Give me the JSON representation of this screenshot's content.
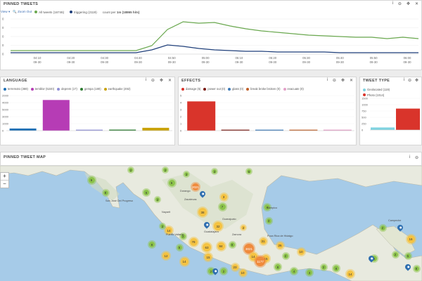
{
  "timeline": {
    "title": "PINNED TWEETS",
    "view_label": "View",
    "zoom_label": "Zoom Out",
    "legend": [
      {
        "label": "All tweets (16746)",
        "color": "#6aa84f"
      },
      {
        "label": "triggering (2119)",
        "color": "#1f3f7a"
      }
    ],
    "count_prefix": "count per",
    "count_interval": "1m",
    "count_total": "(18865 hits)",
    "yticks": [
      "0",
      "0",
      "0",
      "0",
      "0"
    ],
    "xticks": [
      {
        "time": "04:10",
        "date": "09-30"
      },
      {
        "time": "04:20",
        "date": "09-30"
      },
      {
        "time": "04:30",
        "date": "09-30"
      },
      {
        "time": "04:40",
        "date": "09-30"
      },
      {
        "time": "04:50",
        "date": "09-30"
      },
      {
        "time": "05:00",
        "date": "09-30"
      },
      {
        "time": "05:10",
        "date": "09-30"
      },
      {
        "time": "05:20",
        "date": "09-30"
      },
      {
        "time": "05:30",
        "date": "09-30"
      },
      {
        "time": "05:40",
        "date": "09-30"
      },
      {
        "time": "05:50",
        "date": "09-30"
      },
      {
        "time": "06:00",
        "date": "09-30"
      }
    ]
  },
  "chart_data": [
    {
      "type": "line",
      "title": "PINNED TWEETS",
      "x": [
        "04:05",
        "04:10",
        "04:15",
        "04:20",
        "04:25",
        "04:30",
        "04:35",
        "04:40",
        "04:43",
        "04:45",
        "04:48",
        "04:50",
        "04:55",
        "05:00",
        "05:05",
        "05:10",
        "05:15",
        "05:20",
        "05:25",
        "05:30",
        "05:35",
        "05:40",
        "05:45",
        "05:50",
        "05:55",
        "06:00",
        "06:05"
      ],
      "series": [
        {
          "name": "All tweets (16746)",
          "color": "#6aa84f",
          "values": [
            5,
            5,
            5,
            5,
            5,
            5,
            5,
            5,
            5,
            12,
            35,
            46,
            44,
            45,
            40,
            36,
            33,
            31,
            29,
            27,
            26,
            25,
            24,
            24,
            22,
            24,
            22
          ]
        },
        {
          "name": "triggering (2119)",
          "color": "#1f3f7a",
          "values": [
            2,
            2,
            2,
            2,
            2,
            2,
            2,
            2,
            2,
            6,
            13,
            11,
            8,
            6,
            5,
            4,
            4,
            3,
            3,
            3,
            3,
            2,
            2,
            2,
            2,
            2,
            2
          ]
        }
      ]
    },
    {
      "type": "bar",
      "title": "LANGUAGE",
      "categories": [
        "terremoto (369)",
        "temblor (5240)",
        "deprem (17)",
        "gempa (180)",
        "earthquake (492)"
      ],
      "values": [
        369,
        5240,
        17,
        180,
        492
      ],
      "colors": [
        "#1f6fb5",
        "#b63cb5",
        "#8f8fd6",
        "#2e7d32",
        "#c9a20a"
      ],
      "yticks": [
        "2000",
        "4000",
        "5000",
        "3000",
        "1000",
        "0"
      ],
      "ylim": [
        0,
        6000
      ]
    },
    {
      "type": "bar",
      "title": "EFFECTS",
      "categories": [
        "damage (5)",
        "power out (0)",
        "glass (0)",
        "break broke broken (0)",
        "evacuate (0)"
      ],
      "values": [
        5,
        0,
        0,
        0,
        0
      ],
      "colors": [
        "#d9342b",
        "#7a1b14",
        "#3d7ab8",
        "#c0612b",
        "#e3a0c8"
      ],
      "yticks": [
        "5",
        "4",
        "3",
        "2",
        "1",
        "0"
      ],
      "ylim": [
        0,
        6
      ]
    },
    {
      "type": "bar",
      "title": "TWEET TYPE",
      "categories": [
        "Geolocated (119)",
        "Photo (1014)"
      ],
      "values": [
        119,
        1014
      ],
      "colors": [
        "#7fd3e0",
        "#d9342b"
      ],
      "yticks": [
        "1500",
        "1000",
        "750",
        "500",
        "250",
        "0"
      ],
      "ylim": [
        0,
        1500
      ]
    }
  ],
  "language": {
    "title": "LANGUAGE",
    "legend": [
      {
        "label": "terremoto (369)",
        "color": "#1f6fb5"
      },
      {
        "label": "temblor (5240)",
        "color": "#b63cb5"
      },
      {
        "label": "deprem (17)",
        "color": "#8f8fd6"
      },
      {
        "label": "gempa (180)",
        "color": "#2e7d32"
      },
      {
        "label": "earthquake (492)",
        "color": "#c9a20a"
      }
    ]
  },
  "effects": {
    "title": "EFFECTS",
    "legend": [
      {
        "label": "damage (5)",
        "color": "#d9342b"
      },
      {
        "label": "power out (0)",
        "color": "#7a1b14"
      },
      {
        "label": "glass (0)",
        "color": "#3d7ab8"
      },
      {
        "label": "break broke broken (0)",
        "color": "#c0612b"
      },
      {
        "label": "evacuate (0)",
        "color": "#e3a0c8"
      }
    ]
  },
  "tweettype": {
    "title": "TWEET TYPE",
    "legend": [
      {
        "label": "Geolocated (119)",
        "color": "#7fd3e0"
      },
      {
        "label": "Photo (1014)",
        "color": "#d9342b"
      }
    ]
  },
  "panel_icons": {
    "info": "i",
    "delete": "⊖",
    "move": "✥",
    "close": "✕"
  },
  "map": {
    "title": "PINNED TWEET MAP",
    "zoom_in": "+",
    "zoom_out": "−",
    "cities": [
      "Durango",
      "San José Del Progreso",
      "Zacatecas",
      "Nayarit",
      "Guanajuato",
      "Puerto Vallarta",
      "Zamora",
      "Poza Rica de Hidalgo",
      "Campeche",
      "Tampico",
      "Guadalajara"
    ],
    "clusters": [
      {
        "label": "6",
        "type": "g"
      },
      {
        "label": "2",
        "type": "g"
      },
      {
        "label": "8",
        "type": "g"
      },
      {
        "label": "5",
        "type": "g"
      },
      {
        "label": "6",
        "type": "g"
      },
      {
        "label": "2",
        "type": "g"
      },
      {
        "label": "3",
        "type": "g"
      },
      {
        "label": "3",
        "type": "g"
      },
      {
        "label": "6",
        "type": "g"
      },
      {
        "label": "2021",
        "type": "o"
      },
      {
        "label": "3",
        "type": "y"
      },
      {
        "label": "38",
        "type": "y"
      },
      {
        "label": "7",
        "type": "g"
      },
      {
        "label": "6",
        "type": "g"
      },
      {
        "label": "2",
        "type": "y"
      },
      {
        "label": "32",
        "type": "y"
      },
      {
        "label": "14",
        "type": "y"
      },
      {
        "label": "63",
        "type": "y"
      },
      {
        "label": "2",
        "type": "g"
      },
      {
        "label": "78",
        "type": "y"
      },
      {
        "label": "3",
        "type": "g"
      },
      {
        "label": "84",
        "type": "y"
      },
      {
        "label": "8",
        "type": "g"
      },
      {
        "label": "3021",
        "type": "o"
      },
      {
        "label": "31",
        "type": "y"
      },
      {
        "label": "3",
        "type": "g"
      },
      {
        "label": "26",
        "type": "y"
      },
      {
        "label": "2",
        "type": "g"
      },
      {
        "label": "14",
        "type": "y"
      },
      {
        "label": "8",
        "type": "g"
      },
      {
        "label": "15",
        "type": "y"
      },
      {
        "label": "1177",
        "type": "o"
      },
      {
        "label": "10",
        "type": "y"
      },
      {
        "label": "5",
        "type": "g"
      },
      {
        "label": "8",
        "type": "g"
      },
      {
        "label": "12",
        "type": "y"
      },
      {
        "label": "15",
        "type": "y"
      },
      {
        "label": "14",
        "type": "y"
      },
      {
        "label": "2",
        "type": "g"
      },
      {
        "label": "4",
        "type": "g"
      },
      {
        "label": "10",
        "type": "y"
      },
      {
        "label": "8",
        "type": "g"
      },
      {
        "label": "2",
        "type": "g"
      },
      {
        "label": "3",
        "type": "g"
      },
      {
        "label": "14",
        "type": "y"
      },
      {
        "label": "2",
        "type": "g"
      },
      {
        "label": "23",
        "type": "y"
      },
      {
        "label": "2",
        "type": "g"
      },
      {
        "label": "16",
        "type": "y"
      },
      {
        "label": "2",
        "type": "g"
      },
      {
        "label": "3",
        "type": "g"
      },
      {
        "label": "8",
        "type": "g"
      },
      {
        "label": "5",
        "type": "g"
      },
      {
        "label": "2",
        "type": "g"
      }
    ]
  }
}
